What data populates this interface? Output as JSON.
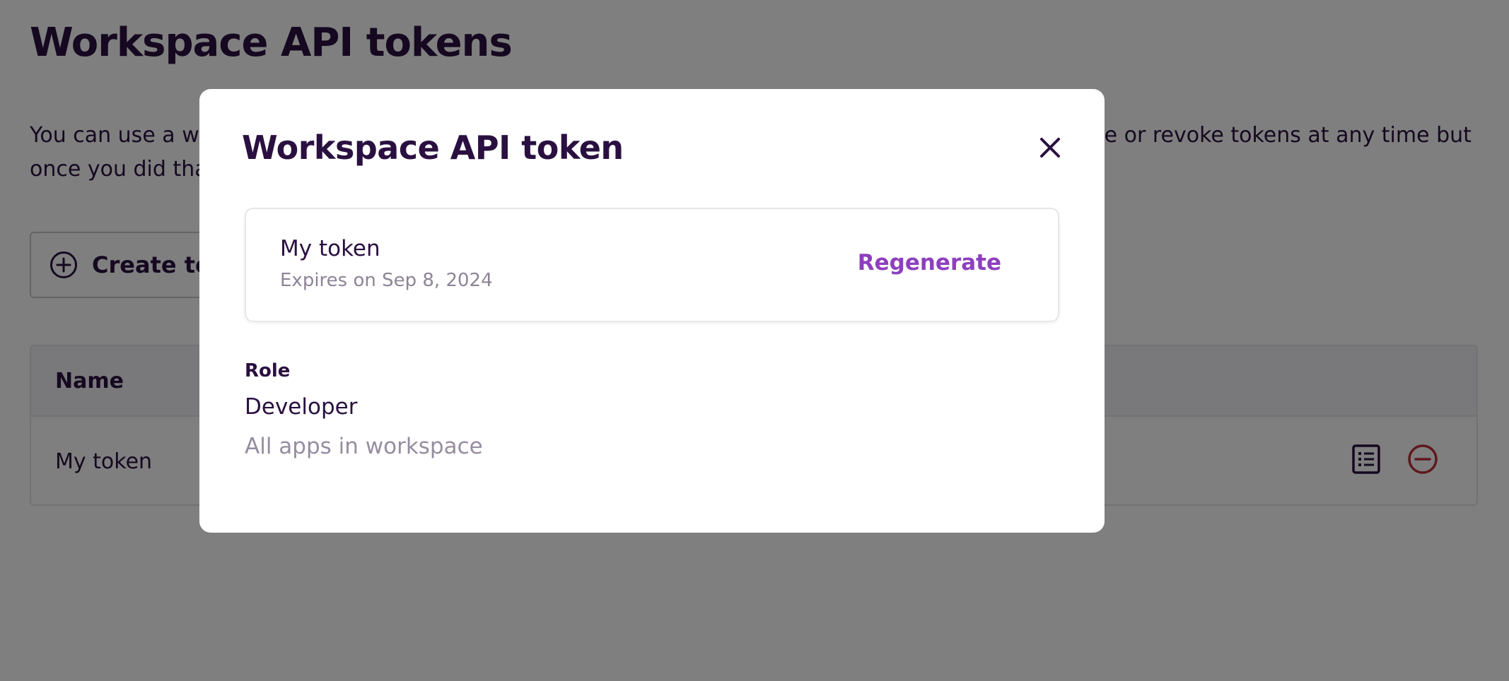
{
  "page": {
    "title": "Workspace API tokens",
    "description": "You can use a workspace API token to access the API of all apps in this workspace. You can regenerate or revoke tokens at any time but once you did that you can never use the old token again.",
    "create_button_label": "Create token"
  },
  "table": {
    "columns": [
      "Name"
    ],
    "rows": [
      {
        "name": "My token",
        "actions": [
          "details-icon",
          "revoke-icon"
        ]
      }
    ]
  },
  "modal": {
    "title": "Workspace API token",
    "close_icon": "close-icon",
    "token": {
      "name": "My token",
      "expires": "Expires on Sep 8, 2024",
      "regenerate_label": "Regenerate"
    },
    "role": {
      "label": "Role",
      "value": "Developer",
      "scope": "All apps in workspace"
    }
  },
  "colors": {
    "text_primary": "#2a1040",
    "accent": "#8e3fbf",
    "danger": "#c0303a",
    "muted": "#8e8496"
  }
}
